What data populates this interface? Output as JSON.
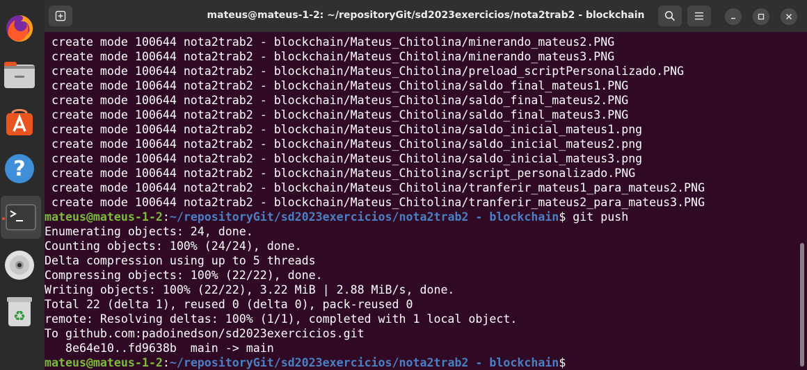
{
  "window": {
    "title": "mateus@mateus-1-2: ~/repositoryGit/sd2023exercicios/nota2trab2 - blockchain"
  },
  "dock": {
    "items": [
      "firefox-icon",
      "files-icon",
      "app-center-icon",
      "help-icon",
      "terminal-icon",
      "disc-icon",
      "trash-icon"
    ]
  },
  "terminal": {
    "output_top": [
      "create mode 100644 nota2trab2 - blockchain/Mateus_Chitolina/minerando_mateus2.PNG",
      "create mode 100644 nota2trab2 - blockchain/Mateus_Chitolina/minerando_mateus3.PNG",
      "create mode 100644 nota2trab2 - blockchain/Mateus_Chitolina/preload_scriptPersonalizado.PNG",
      "create mode 100644 nota2trab2 - blockchain/Mateus_Chitolina/saldo_final_mateus1.PNG",
      "create mode 100644 nota2trab2 - blockchain/Mateus_Chitolina/saldo_final_mateus2.PNG",
      "create mode 100644 nota2trab2 - blockchain/Mateus_Chitolina/saldo_final_mateus3.PNG",
      "create mode 100644 nota2trab2 - blockchain/Mateus_Chitolina/saldo_inicial_mateus1.png",
      "create mode 100644 nota2trab2 - blockchain/Mateus_Chitolina/saldo_inicial_mateus2.png",
      "create mode 100644 nota2trab2 - blockchain/Mateus_Chitolina/saldo_inicial_mateus3.png",
      "create mode 100644 nota2trab2 - blockchain/Mateus_Chitolina/script_personalizado.PNG",
      "create mode 100644 nota2trab2 - blockchain/Mateus_Chitolina/tranferir_mateus1_para_mateus2.PNG",
      "create mode 100644 nota2trab2 - blockchain/Mateus_Chitolina/tranferir_mateus2_para_mateus3.PNG"
    ],
    "prompt_user": "mateus@mateus-1-2",
    "prompt_path": "~/repositoryGit/sd2023exercicios/nota2trab2 - blockchain",
    "command": " git push",
    "output_push": [
      "Enumerating objects: 24, done.",
      "Counting objects: 100% (24/24), done.",
      "Delta compression using up to 5 threads",
      "Compressing objects: 100% (22/22), done.",
      "Writing objects: 100% (22/22), 3.22 MiB | 2.88 MiB/s, done.",
      "Total 22 (delta 1), reused 0 (delta 0), pack-reused 0",
      "remote: Resolving deltas: 100% (1/1), completed with 1 local object.",
      "To github.com:padoinedson/sd2023exercicios.git",
      "   8e64e10..fd9638b  main -> main"
    ]
  }
}
